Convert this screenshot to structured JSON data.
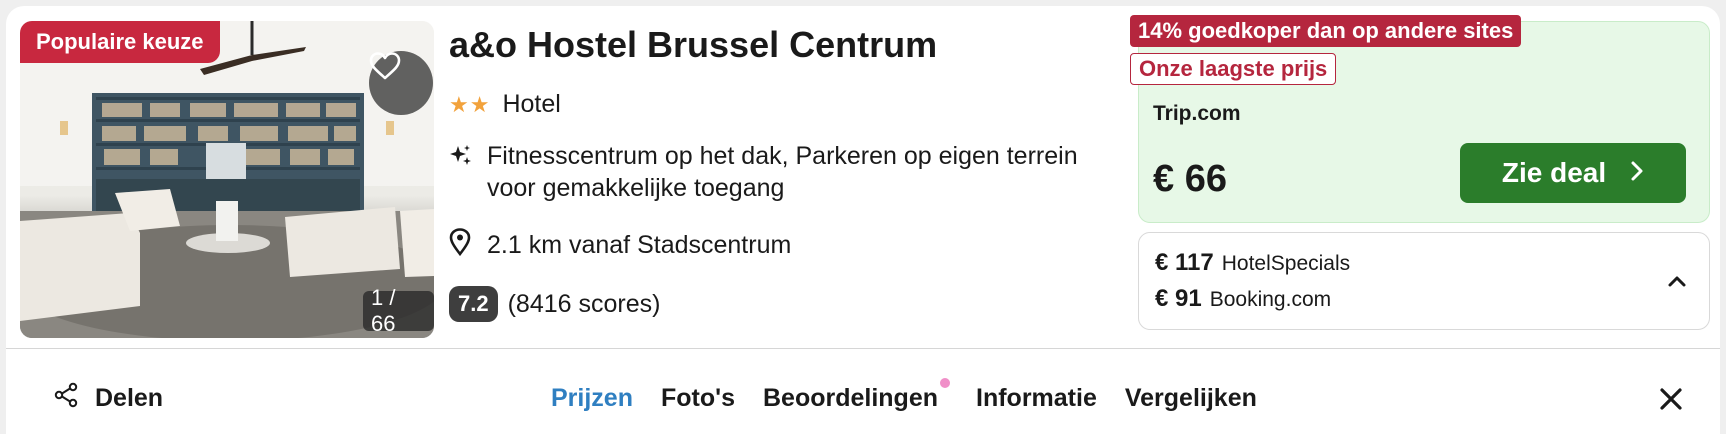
{
  "badges": {
    "popular": "Populaire keuze",
    "cheaper": "14% goedkoper dan op andere sites",
    "lowest": "Onze laagste prijs"
  },
  "photo": {
    "counter": "1 / 66"
  },
  "hotel": {
    "name": "a&o Hostel Brussel Centrum",
    "stars": "★★",
    "star_count": 2,
    "type": "Hotel",
    "amenities": "Fitnesscentrum op het dak, Parkeren op eigen terrein voor gemakkelijke toegang",
    "distance": "2.1 km vanaf Stadscentrum",
    "score": "7.2",
    "reviews": "(8416 scores)"
  },
  "deal": {
    "provider": "Trip.com",
    "price": "€ 66",
    "button_label": "Zie deal"
  },
  "other_prices": [
    {
      "price": "€ 117",
      "provider": "HotelSpecials"
    },
    {
      "price": "€ 91",
      "provider": "Booking.com"
    }
  ],
  "nav": {
    "share_label": "Delen",
    "tabs": [
      {
        "label": "Prijzen"
      },
      {
        "label": "Foto's"
      },
      {
        "label": "Beoordelingen"
      },
      {
        "label": "Informatie"
      },
      {
        "label": "Vergelijken"
      }
    ]
  },
  "colors": {
    "badge_red": "#c8283f",
    "deal_green": "#2b7d2b",
    "deal_bg": "#e7f8e7",
    "active_tab_blue": "#2f7fc1",
    "star_orange": "#f2a23c"
  },
  "icons": [
    "heart-icon",
    "sparkle-icon",
    "location-pin-icon",
    "chevron-right-icon",
    "chevron-up-icon",
    "share-icon",
    "close-icon"
  ]
}
